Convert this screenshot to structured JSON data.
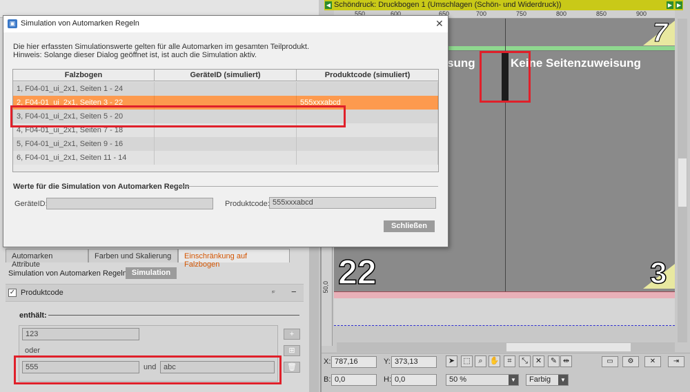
{
  "dialog": {
    "title": "Simulation von Automarken Regeln",
    "info_line1": "Die hier erfassten Simulationswerte gelten für alle Automarken im gesamten Teilprodukt.",
    "info_line2": "Hinweis: Solange dieser Dialog geöffnet ist, ist auch die Simulation aktiv.",
    "table": {
      "headers": [
        "Falzbogen",
        "GeräteID (simuliert)",
        "Produktcode (simuliert)"
      ],
      "rows": [
        {
          "falzbogen": "1, F04-01_ui_2x1, Seiten 1 - 24",
          "geraet": "",
          "produkt": ""
        },
        {
          "falzbogen": "2, F04-01_ui_2x1, Seiten 3 - 22",
          "geraet": "",
          "produkt": "555xxxabcd"
        },
        {
          "falzbogen": "3, F04-01_ui_2x1, Seiten 5 - 20",
          "geraet": "",
          "produkt": ""
        },
        {
          "falzbogen": "4, F04-01_ui_2x1, Seiten 7 - 18",
          "geraet": "",
          "produkt": ""
        },
        {
          "falzbogen": "5, F04-01_ui_2x1, Seiten 9 - 16",
          "geraet": "",
          "produkt": ""
        },
        {
          "falzbogen": "6, F04-01_ui_2x1, Seiten 11 - 14",
          "geraet": "",
          "produkt": ""
        }
      ],
      "selected_row": 1
    },
    "section_title": "Werte für die Simulation von Automarken Regeln",
    "geraet_label": "GeräteID:",
    "geraet_value": "",
    "produkt_label": "Produktcode:",
    "produkt_value": "555xxxabcd",
    "close_label": "Schließen"
  },
  "left_panel": {
    "tabs": [
      "Automarken Attribute",
      "Farben und Skalierung",
      "Einschränkung auf Falzbogen"
    ],
    "active_tab": 2,
    "sim_label": "Simulation von Automarken Regeln:",
    "sim_button": "Simulation",
    "produktcode_label": "Produktcode",
    "enthalt_label": "enthält:",
    "value1": "123",
    "oder_label": "oder",
    "value2": "555",
    "und_label": "und",
    "value3": "abc"
  },
  "canvas": {
    "title": "Schöndruck:  Druckbogen 1 (Umschlagen (Schön- und Widerdruck))",
    "ruler_ticks": [
      "550",
      "600",
      "650",
      "700",
      "750",
      "800",
      "850",
      "900"
    ],
    "ruler_left_label": "50,0",
    "page_num_top": "7",
    "page_label_left": "sung",
    "page_label_right": "Keine Seitenzuweisung",
    "page_num_bottom_left": "22",
    "page_num_bottom_right": "3"
  },
  "toolbar": {
    "x_label": "X:",
    "x_value": "787,16",
    "y_label": "Y:",
    "y_value": "373,13",
    "b_label": "B:",
    "b_value": "0,0",
    "h_label": "H:",
    "h_value": "0,0",
    "zoom_value": "50 %",
    "color_value": "Farbig"
  },
  "colors": {
    "selected_row": "#fd9a4e",
    "highlight_red": "#e0202a",
    "active_tab_text": "#d35400",
    "title_bar": "#c9c918"
  }
}
